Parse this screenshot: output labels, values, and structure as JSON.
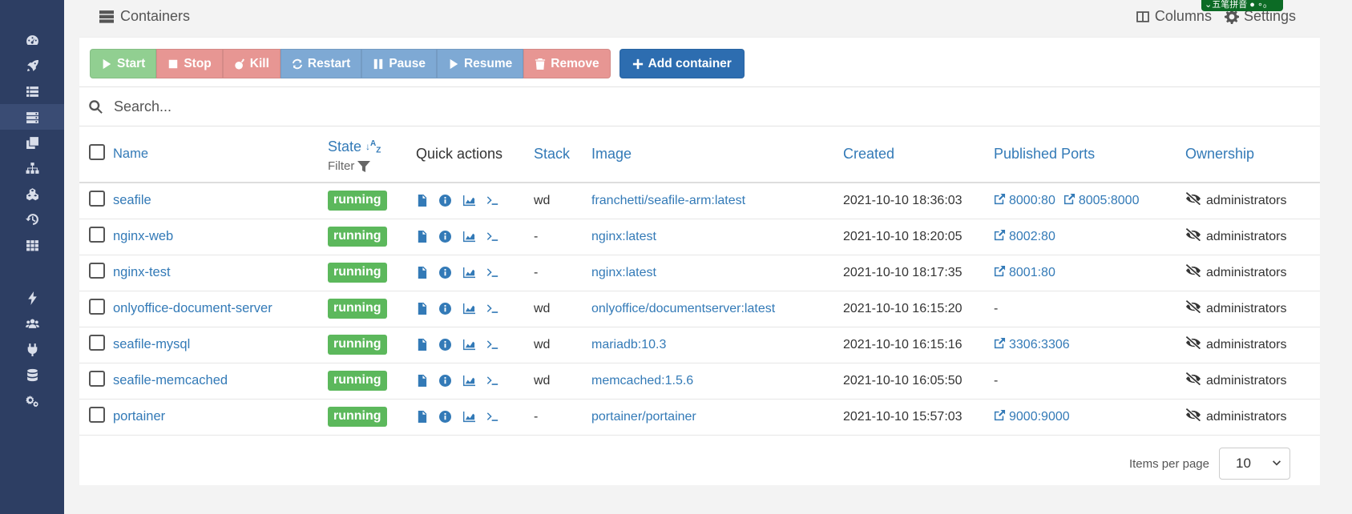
{
  "sidebar": {
    "icons": [
      "dashboard-icon",
      "rocket-icon",
      "list-icon",
      "server-icon",
      "clone-icon",
      "sitemap-icon",
      "cubes-icon",
      "history-icon",
      "th-icon",
      "bolt-icon",
      "users-icon",
      "plug-icon",
      "database-icon",
      "cogs-icon"
    ]
  },
  "header": {
    "title": "Containers",
    "columns_label": "Columns",
    "settings_label": "Settings",
    "ime_text": "⌄五笔拼音 ● ∘₀"
  },
  "toolbar": {
    "start": "Start",
    "stop": "Stop",
    "kill": "Kill",
    "restart": "Restart",
    "pause": "Pause",
    "resume": "Resume",
    "remove": "Remove",
    "add": "Add container"
  },
  "search": {
    "placeholder": "Search..."
  },
  "table": {
    "headers": {
      "name": "Name",
      "state": "State",
      "filter": "Filter",
      "quick_actions": "Quick actions",
      "stack": "Stack",
      "image": "Image",
      "created": "Created",
      "ports": "Published Ports",
      "ownership": "Ownership"
    },
    "rows": [
      {
        "name": "seafile",
        "state": "running",
        "stack": "wd",
        "image": "franchetti/seafile-arm:latest",
        "created": "2021-10-10 18:36:03",
        "ports": [
          "8000:80",
          "8005:8000"
        ],
        "ownership": "administrators"
      },
      {
        "name": "nginx-web",
        "state": "running",
        "stack": "-",
        "image": "nginx:latest",
        "created": "2021-10-10 18:20:05",
        "ports": [
          "8002:80"
        ],
        "ownership": "administrators"
      },
      {
        "name": "nginx-test",
        "state": "running",
        "stack": "-",
        "image": "nginx:latest",
        "created": "2021-10-10 18:17:35",
        "ports": [
          "8001:80"
        ],
        "ownership": "administrators"
      },
      {
        "name": "onlyoffice-document-server",
        "state": "running",
        "stack": "wd",
        "image": "onlyoffice/documentserver:latest",
        "created": "2021-10-10 16:15:20",
        "ports": [],
        "ownership": "administrators"
      },
      {
        "name": "seafile-mysql",
        "state": "running",
        "stack": "wd",
        "image": "mariadb:10.3",
        "created": "2021-10-10 16:15:16",
        "ports": [
          "3306:3306"
        ],
        "ownership": "administrators"
      },
      {
        "name": "seafile-memcached",
        "state": "running",
        "stack": "wd",
        "image": "memcached:1.5.6",
        "created": "2021-10-10 16:05:50",
        "ports": [],
        "ownership": "administrators"
      },
      {
        "name": "portainer",
        "state": "running",
        "stack": "-",
        "image": "portainer/portainer",
        "created": "2021-10-10 15:57:03",
        "ports": [
          "9000:9000"
        ],
        "ownership": "administrators"
      }
    ],
    "empty_ports": "-"
  },
  "pagination": {
    "items_per_page_label": "Items per page",
    "items_per_page_value": "10"
  },
  "colors": {
    "sidebar_bg": "#2d3e63",
    "running": "#5cb85c",
    "link": "#337ab7",
    "add_button": "#2d6db0"
  }
}
